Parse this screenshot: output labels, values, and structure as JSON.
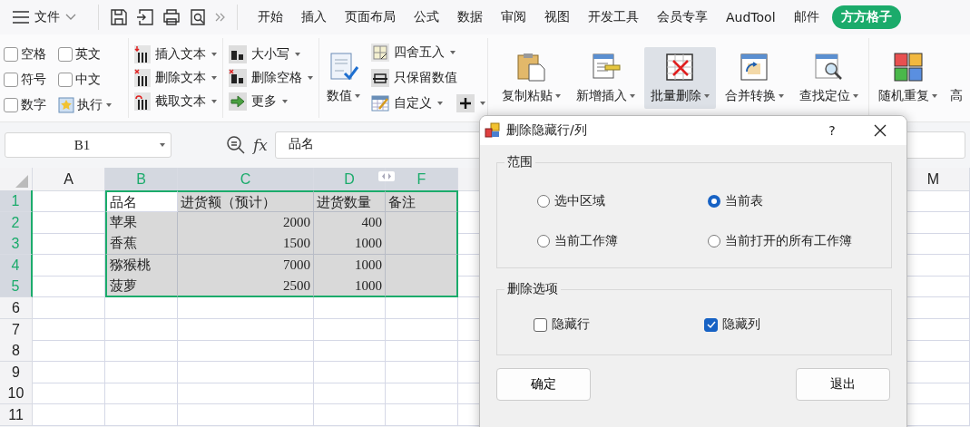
{
  "menu": {
    "label": "文件"
  },
  "tabs": [
    {
      "label": "开始",
      "selected": false
    },
    {
      "label": "插入",
      "selected": false
    },
    {
      "label": "页面布局",
      "selected": false
    },
    {
      "label": "公式",
      "selected": false
    },
    {
      "label": "数据",
      "selected": false
    },
    {
      "label": "审阅",
      "selected": false
    },
    {
      "label": "视图",
      "selected": false
    },
    {
      "label": "开发工具",
      "selected": false
    },
    {
      "label": "会员专享",
      "selected": false
    },
    {
      "label": "AudTool",
      "selected": false
    },
    {
      "label": "邮件",
      "selected": false
    },
    {
      "label": "方方格子",
      "selected": true
    }
  ],
  "ribbon": {
    "checkboxes": [
      {
        "label": "空格",
        "checked": false
      },
      {
        "label": "英文",
        "checked": false
      },
      {
        "label": "符号",
        "checked": false
      },
      {
        "label": "中文",
        "checked": false
      },
      {
        "label": "数字",
        "checked": false
      }
    ],
    "execute": {
      "label": "执行"
    },
    "text_tools": [
      {
        "label": "插入文本"
      },
      {
        "label": "删除文本"
      },
      {
        "label": "截取文本"
      }
    ],
    "case_tools": [
      {
        "label": "大小写"
      },
      {
        "label": "删除空格"
      },
      {
        "label": "更多"
      }
    ],
    "number_button": {
      "label": "数值"
    },
    "number_tools": [
      {
        "label": "四舍五入",
        "dropdown": true
      },
      {
        "label": "只保留数值",
        "dropdown": false
      },
      {
        "label": "自定义",
        "dropdown": true
      }
    ],
    "large_buttons": [
      {
        "label": "复制粘贴",
        "selected": false
      },
      {
        "label": "新增插入",
        "selected": false
      },
      {
        "label": "批量删除",
        "selected": true
      },
      {
        "label": "合并转换",
        "selected": false
      },
      {
        "label": "查找定位",
        "selected": false
      }
    ],
    "extra_buttons": [
      {
        "label": "随机重复",
        "dropdown": true
      },
      {
        "label": "高",
        "dropdown": false
      }
    ]
  },
  "name_box": {
    "value": "B1"
  },
  "formula": {
    "function_label": "fx",
    "value": "品名"
  },
  "sheet": {
    "columns": [
      {
        "label": "A",
        "selected": false
      },
      {
        "label": "B",
        "selected": true
      },
      {
        "label": "C",
        "selected": true
      },
      {
        "label": "D",
        "selected": true
      },
      {
        "label": "F",
        "selected": true
      },
      {
        "label": "M",
        "selected": false
      }
    ],
    "rows": [
      {
        "label": "1",
        "selected": true,
        "cells": [
          null,
          {
            "text": "品名",
            "active": true,
            "kind": "text"
          },
          {
            "text": "进货额（预计）",
            "active": false,
            "kind": "text"
          },
          {
            "text": "进货数量",
            "active": false,
            "kind": "text"
          },
          {
            "text": "备注",
            "active": false,
            "kind": "text"
          }
        ]
      },
      {
        "label": "2",
        "selected": true,
        "cells": [
          null,
          {
            "text": "苹果",
            "active": false,
            "kind": "text"
          },
          {
            "text": "2000",
            "active": false,
            "kind": "number"
          },
          {
            "text": "400",
            "active": false,
            "kind": "number"
          },
          null
        ]
      },
      {
        "label": "3",
        "selected": true,
        "cells": [
          null,
          {
            "text": "香蕉",
            "active": false,
            "kind": "text"
          },
          {
            "text": "1500",
            "active": false,
            "kind": "number"
          },
          {
            "text": "1000",
            "active": false,
            "kind": "number"
          },
          null
        ]
      },
      {
        "label": "4",
        "selected": true,
        "cells": [
          null,
          {
            "text": "猕猴桃",
            "active": false,
            "kind": "text"
          },
          {
            "text": "7000",
            "active": false,
            "kind": "number"
          },
          {
            "text": "1000",
            "active": false,
            "kind": "number"
          },
          null
        ]
      },
      {
        "label": "5",
        "selected": true,
        "cells": [
          null,
          {
            "text": "菠萝",
            "active": false,
            "kind": "text"
          },
          {
            "text": "2500",
            "active": false,
            "kind": "number"
          },
          {
            "text": "1000",
            "active": false,
            "kind": "number"
          },
          null
        ]
      },
      {
        "label": "6",
        "selected": false,
        "cells": [
          null,
          null,
          null,
          null,
          null
        ]
      },
      {
        "label": "7",
        "selected": false,
        "cells": [
          null,
          null,
          null,
          null,
          null
        ]
      },
      {
        "label": "8",
        "selected": false,
        "cells": [
          null,
          null,
          null,
          null,
          null
        ]
      },
      {
        "label": "9",
        "selected": false,
        "cells": [
          null,
          null,
          null,
          null,
          null
        ]
      },
      {
        "label": "10",
        "selected": false,
        "cells": [
          null,
          null,
          null,
          null,
          null
        ]
      },
      {
        "label": "11",
        "selected": false,
        "cells": [
          null,
          null,
          null,
          null,
          null
        ]
      }
    ]
  },
  "dialog": {
    "title": "删除隐藏行/列",
    "help": "?",
    "scope": {
      "title": "范围",
      "options": [
        {
          "label": "选中区域",
          "selected": false
        },
        {
          "label": "当前表",
          "selected": true
        },
        {
          "label": "当前工作簿",
          "selected": false
        },
        {
          "label": "当前打开的所有工作簿",
          "selected": false
        }
      ]
    },
    "options": {
      "title": "删除选项",
      "items": [
        {
          "label": "隐藏行",
          "checked": false
        },
        {
          "label": "隐藏列",
          "checked": true
        }
      ]
    },
    "buttons": [
      "确定",
      "退出"
    ]
  }
}
